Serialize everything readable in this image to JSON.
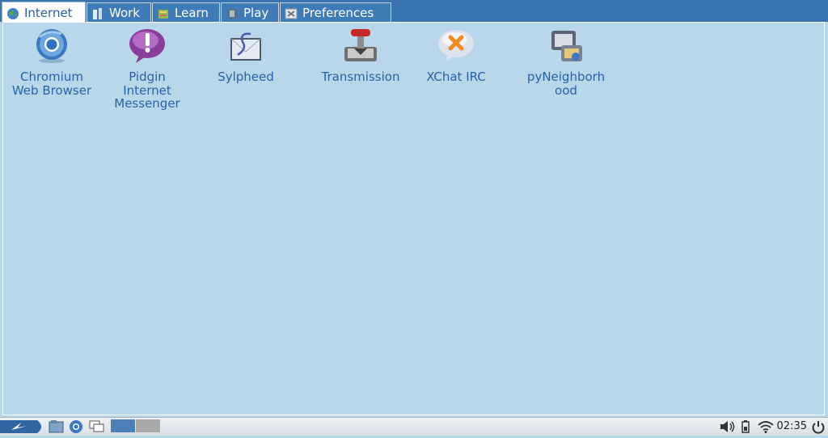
{
  "tabs": [
    {
      "label": "Internet",
      "icon": "globe-icon",
      "active": true
    },
    {
      "label": "Work",
      "icon": "pencil-icon",
      "active": false
    },
    {
      "label": "Learn",
      "icon": "book-icon",
      "active": false
    },
    {
      "label": "Play",
      "icon": "film-icon",
      "active": false
    },
    {
      "label": "Preferences",
      "icon": "settings-icon",
      "active": false
    }
  ],
  "apps": [
    {
      "line1": "Chromium",
      "line2": "Web Browser",
      "line3": "",
      "icon": "chromium-icon"
    },
    {
      "line1": "Pidgin",
      "line2": "Internet",
      "line3": "Messenger",
      "icon": "pidgin-icon"
    },
    {
      "line1": "Sylpheed",
      "line2": "",
      "line3": "",
      "icon": "sylpheed-icon"
    },
    {
      "line1": "Transmission",
      "line2": "",
      "line3": "",
      "icon": "transmission-icon"
    },
    {
      "line1": "XChat IRC",
      "line2": "",
      "line3": "",
      "icon": "xchat-icon"
    },
    {
      "line1": "pyNeighborh",
      "line2": "ood",
      "line3": "",
      "icon": "pyneighborhood-icon"
    }
  ],
  "taskbar": {
    "clock": "02:35",
    "colors": {
      "accent": "#3a74b0",
      "desktop": "#b8d7ea",
      "label": "#2a62a8"
    }
  }
}
